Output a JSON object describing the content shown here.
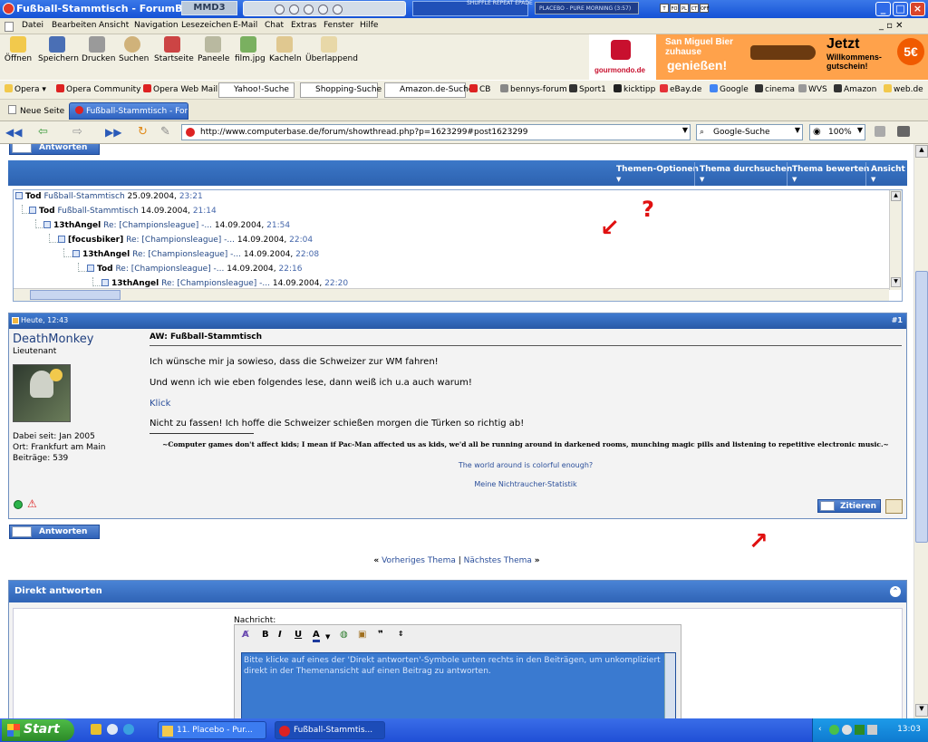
{
  "window": {
    "title": "Fußball-Stammtisch - ForumBase",
    "mmd_label": "MMD3",
    "placebo_label": "PLACEBO - PURE MORNING (3:57)",
    "shuffle_label": "SHUFFLE REPEAT EPADE",
    "mini_buttons": [
      "T",
      "FO",
      "PL",
      "CT",
      "OFF"
    ]
  },
  "menu": [
    "Datei",
    "Bearbeiten",
    "Ansicht",
    "Navigation",
    "Lesezeichen",
    "E-Mail",
    "Chat",
    "Extras",
    "Fenster",
    "Hilfe"
  ],
  "toolbar": [
    "Öffnen",
    "Speichern",
    "Drucken",
    "Suchen",
    "Startseite",
    "Paneele",
    "film.jpg",
    "Kacheln",
    "Überlappend"
  ],
  "ad": {
    "line1": "San Miguel Bier",
    "line2": "zuhause",
    "line3": "genießen!",
    "cta": "Jetzt",
    "cta2": "Willkommens-",
    "cta3": "gutschein!",
    "badge": "5€",
    "brand": "gourmondo.de"
  },
  "bookmarks": {
    "opera": "Opera",
    "items": [
      "Opera Community",
      "Opera Web Mail"
    ],
    "search_boxes": [
      "Yahoo!-Suche",
      "Shopping-Suche",
      "Amazon.de-Suche"
    ],
    "links": [
      "CB",
      "bennys-forum",
      "Sport1",
      "kicktipp",
      "eBay.de",
      "Google",
      "cinema",
      "WVS",
      "Amazon",
      "web.de"
    ]
  },
  "tabs": {
    "new_tab": "Neue Seite",
    "active": "Fußball-Stammtisch - Foru..."
  },
  "address": {
    "url": "http://www.computerbase.de/forum/showthread.php?p=1623299#post1623299",
    "search_placeholder": "Google-Suche",
    "zoom": "100%"
  },
  "thread": {
    "reply_button": "Antworten",
    "options": [
      "Themen-Optionen",
      "Thema durchsuchen",
      "Thema bewerten",
      "Ansicht"
    ],
    "tree": [
      {
        "user": "Tod",
        "title": "Fußball-Stammtisch",
        "date": "25.09.2004,",
        "time": "23:21"
      },
      {
        "user": "Tod",
        "title": "Fußball-Stammtisch",
        "date": "14.09.2004,",
        "time": "21:14"
      },
      {
        "user": "13thAngel",
        "title": "Re: [Championsleague] -...",
        "date": "14.09.2004,",
        "time": "21:54"
      },
      {
        "user": "[focusbiker]",
        "title": "Re: [Championsleague] -...",
        "date": "14.09.2004,",
        "time": "22:04"
      },
      {
        "user": "13thAngel",
        "title": "Re: [Championsleague] -...",
        "date": "14.09.2004,",
        "time": "22:08"
      },
      {
        "user": "Tod",
        "title": "Re: [Championsleague] -...",
        "date": "14.09.2004,",
        "time": "22:16"
      },
      {
        "user": "13thAngel",
        "title": "Re: [Championsleague] -...",
        "date": "14.09.2004,",
        "time": "22:20"
      }
    ]
  },
  "post": {
    "date": "Heute, 12:43",
    "number": "#1",
    "username": "DeathMonkey",
    "rank": "Lieutenant",
    "joined": "Dabei seit: Jan 2005",
    "location": "Ort: Frankfurt am Main",
    "posts": "Beiträge: 539",
    "title": "AW: Fußball-Stammtisch",
    "line1": "Ich wünsche mir ja sowieso, dass die Schweizer zur WM fahren!",
    "line2": "Und wenn ich wie eben folgendes lese, dann weiß ich u.a auch warum!",
    "link": "Klick",
    "line3": "Nicht zu fassen! Ich hoffe die Schweizer schießen morgen die Türken so richtig ab!",
    "sig1": "~Computer games don't affect kids; I mean if Pac-Man affected us as kids, we'd all be running around in darkened rooms, munching magic pills and listening to repetitive electronic music.~",
    "sig2": "The world around is colorful enough?",
    "sig3": "Meine Nichtraucher-Statistik",
    "quote_button": "Zitieren"
  },
  "nav": {
    "prev": "Vorheriges Thema",
    "sep": "|",
    "next": "Nächstes Thema"
  },
  "quick_reply": {
    "title": "Direkt antworten",
    "label": "Nachricht:",
    "text": "Bitte klicke auf eines der 'Direkt antworten'-Symbole unten rechts in den Beiträgen, um unkompliziert direkt in der Themenansicht auf einen Beitrag zu antworten."
  },
  "taskbar": {
    "start": "Start",
    "items": [
      "11. Placebo - Pur...",
      "Fußball-Stammtis..."
    ],
    "clock": "13:03"
  },
  "annotation": {
    "question": "?"
  }
}
